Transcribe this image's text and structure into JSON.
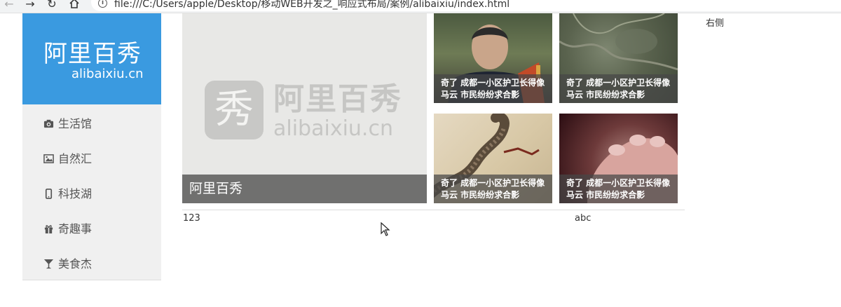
{
  "browser": {
    "url": "file:///C:/Users/apple/Desktop/移动WEB开发之_响应式布局/案例/alibaixiu/index.html",
    "back_icon": "arrow-left-icon",
    "forward_icon": "arrow-right-icon",
    "reload_icon": "reload-icon",
    "home_icon": "home-icon"
  },
  "logo": {
    "name_cn": "阿里百秀",
    "name_en": "alibaixiu.cn"
  },
  "menu": [
    {
      "label": "生活馆",
      "icon": "camera-icon"
    },
    {
      "label": "自然汇",
      "icon": "picture-icon"
    },
    {
      "label": "科技湖",
      "icon": "phone-icon"
    },
    {
      "label": "奇趣事",
      "icon": "gift-icon"
    },
    {
      "label": "美食杰",
      "icon": "glass-icon"
    }
  ],
  "featured": {
    "watermark_char": "秀",
    "watermark_cn": "阿里百秀",
    "watermark_en": "alibaixiu.cn",
    "caption": "阿里百秀"
  },
  "news": [
    {
      "caption": "奇了 成都一小区护卫长得像马云 市民纷纷求合影"
    },
    {
      "caption": "奇了 成都一小区护卫长得像马云 市民纷纷求合影"
    },
    {
      "caption": "奇了 成都一小区护卫长得像马云 市民纷纷求合影"
    },
    {
      "caption": "奇了 成都一小区护卫长得像马云 市民纷纷求合影"
    }
  ],
  "footer": {
    "left": "123",
    "right": "abc"
  },
  "aside": {
    "text": "右侧"
  },
  "colors": {
    "brand_blue": "#3a9ae0",
    "sidebar_bg": "#f0f0f0",
    "caption_overlay": "#5f5f5f"
  }
}
